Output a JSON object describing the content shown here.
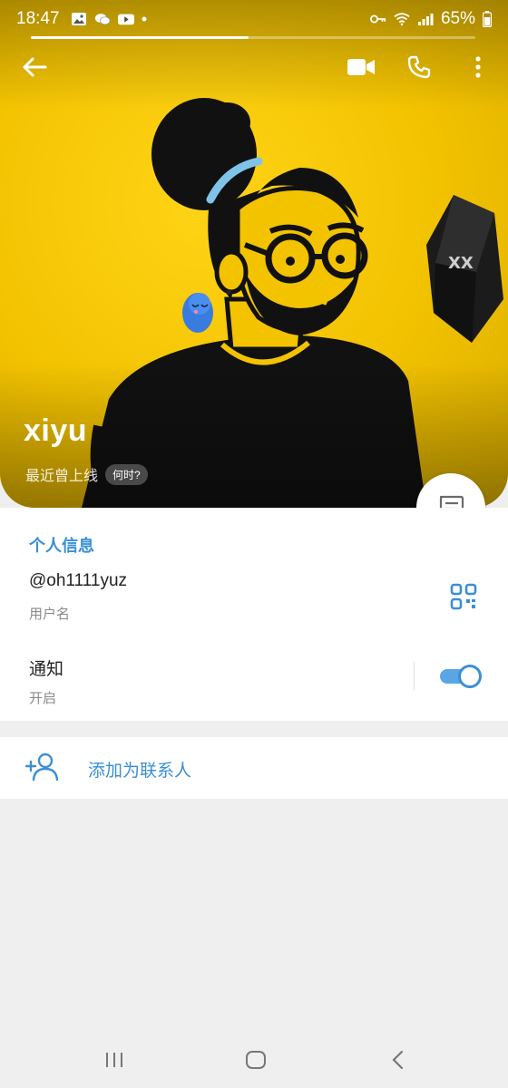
{
  "status_bar": {
    "time": "18:47",
    "battery": "65%",
    "left_icons": [
      "gallery-icon",
      "wechat-icon",
      "youtube-icon",
      "dot-icon"
    ],
    "right_icons": [
      "key-icon",
      "wifi-icon",
      "signal-icon",
      "battery-icon"
    ]
  },
  "video_progress": 0.49,
  "toolbar": {
    "back_icon": "arrow-left-icon",
    "video_icon": "video-call-icon",
    "phone_icon": "phone-icon",
    "more_icon": "more-vertical-icon"
  },
  "profile": {
    "name": "xiyu",
    "last_seen": "最近曾上线",
    "when_chip": "何时?"
  },
  "info": {
    "section_title": "个人信息",
    "username_value": "@oh1111yuz",
    "username_label": "用户名",
    "notifications_label": "通知",
    "notifications_value": "开启",
    "notifications_enabled": true
  },
  "actions": {
    "add_contact": "添加为联系人"
  },
  "colors": {
    "accent": "#3a8fd6",
    "hero_yellow": "#f3c300",
    "background": "#efefef"
  }
}
